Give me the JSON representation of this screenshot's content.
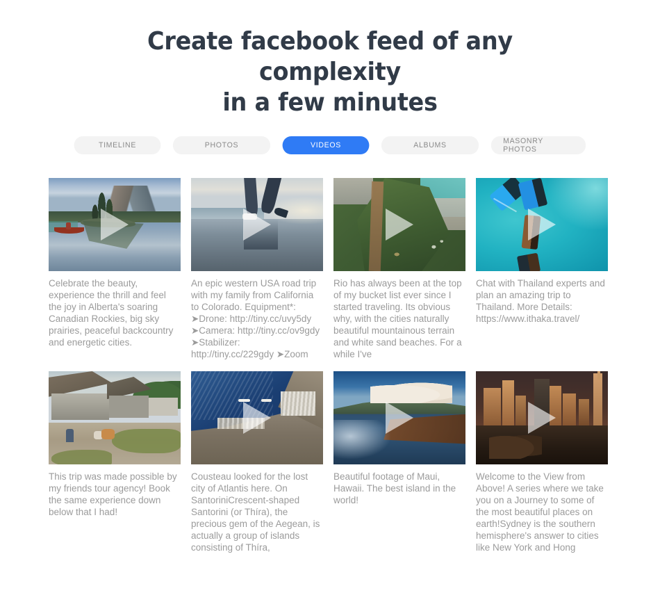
{
  "header": {
    "title_line1": "Create facebook feed of any complexity",
    "title_line2": "in a few minutes"
  },
  "tabs": [
    {
      "label": "TIMELINE",
      "active": false
    },
    {
      "label": "PHOTOS",
      "active": false
    },
    {
      "label": "VIDEOS",
      "active": true
    },
    {
      "label": "ALBUMS",
      "active": false
    },
    {
      "label": "MASONRY PHOTOS",
      "active": false
    }
  ],
  "colors": {
    "accent": "#2f7bf5",
    "tab_background": "#f3f3f3",
    "tab_text": "#8b8b8b",
    "heading": "#313b48",
    "caption": "#9b9b9b",
    "page_background": "#ffffff"
  },
  "feed": {
    "items": [
      {
        "caption": "Celebrate the beauty, experience the thrill and feel the joy in Alberta's soaring Canadian Rockies, big sky prairies, peaceful backcountry and energetic cities.",
        "media_type": "video",
        "has_play_button": true,
        "thumbnail_alt": "Canoe on a calm mountain lake in the Canadian Rockies"
      },
      {
        "caption": "An epic western USA road trip with my family from California to Colorado. Equipment*: ➤Drone: http://tiny.cc/uvy5dy ➤Camera: http://tiny.cc/ov9gdy ➤Stabilizer: http://tiny.cc/229gdy ➤Zoom",
        "media_type": "video",
        "has_play_button": true,
        "thumbnail_alt": "Person walking on a wet beach at dusk"
      },
      {
        "caption": "Rio has always been at the top of my bucket list ever since I started traveling. Its obvious why, with the cities naturally beautiful mountainous terrain and white sand beaches. For a while I've",
        "media_type": "video",
        "has_play_button": true,
        "thumbnail_alt": "Aerial view of a green mountain ridge in Rio de Janeiro"
      },
      {
        "caption": "Chat with Thailand experts and plan an amazing trip to Thailand. More Details: https://www.ithaka.travel/",
        "media_type": "video",
        "has_play_button": true,
        "thumbnail_alt": "Aerial view of longtail boats on turquoise water in Thailand"
      },
      {
        "caption": "This trip was made possible by my friends tour agency! Book the same experience down below that I had!",
        "media_type": "video",
        "has_play_button": false,
        "thumbnail_alt": "Village with thatched stilt houses along a dirt path"
      },
      {
        "caption": "Cousteau looked for the lost city of Atlantis here. On SantoriniCrescent-shaped Santorini (or Thíra), the precious gem of the Aegean, is actually a group of islands consisting of Thíra,",
        "media_type": "video",
        "has_play_button": true,
        "thumbnail_alt": "Aerial view of the Santorini coastline and deep blue sea"
      },
      {
        "caption": "Beautiful footage of Maui, Hawaii. The best island in the world!",
        "media_type": "video",
        "has_play_button": true,
        "thumbnail_alt": "Maui shoreline at sunset with clouds over the island"
      },
      {
        "caption": "Welcome to the View from Above! A series where we take you on a Journey to some of the most beautiful places on earth!Sydney is the southern hemisphere's answer to cities like New York and Hong",
        "media_type": "video",
        "has_play_button": true,
        "thumbnail_alt": "City skyline glowing orange at dusk"
      }
    ]
  }
}
